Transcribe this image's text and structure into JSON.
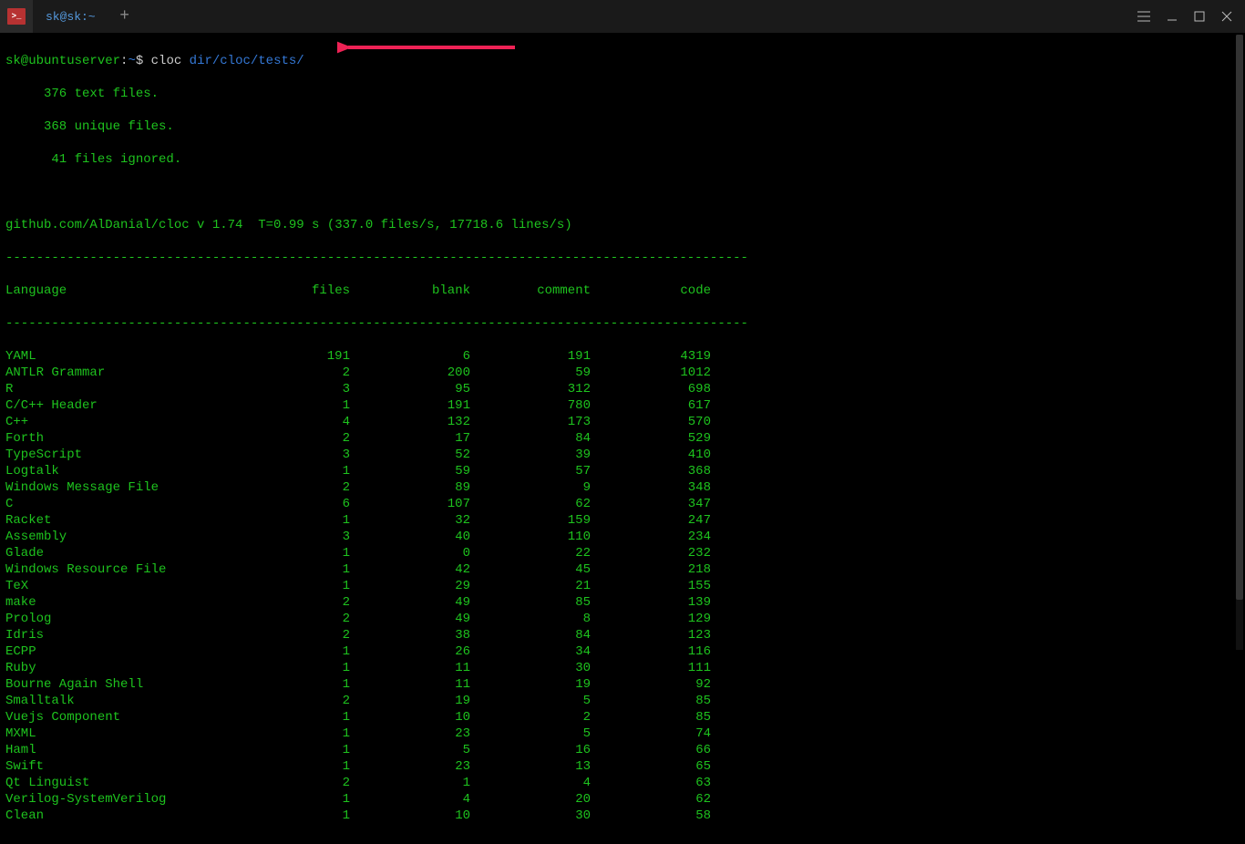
{
  "titlebar": {
    "tab_label": "sk@sk:~",
    "add_tab": "+"
  },
  "prompt": {
    "user_host": "sk@ubuntuserver",
    "path": "~",
    "command": "cloc ",
    "command_path": "dir/cloc/tests/"
  },
  "summary": {
    "line1": "     376 text files.",
    "line2": "     368 unique files.",
    "line3": "      41 files ignored."
  },
  "stats_line": "github.com/AlDanial/cloc v 1.74  T=0.99 s (337.0 files/s, 17718.6 lines/s)",
  "dashes": "-------------------------------------------------------------------------------------------------",
  "headers": {
    "language": "Language",
    "files": "files",
    "blank": "blank",
    "comment": "comment",
    "code": "code"
  },
  "rows": [
    {
      "lang": "YAML",
      "files": "191",
      "blank": "6",
      "comment": "191",
      "code": "4319"
    },
    {
      "lang": "ANTLR Grammar",
      "files": "2",
      "blank": "200",
      "comment": "59",
      "code": "1012"
    },
    {
      "lang": "R",
      "files": "3",
      "blank": "95",
      "comment": "312",
      "code": "698"
    },
    {
      "lang": "C/C++ Header",
      "files": "1",
      "blank": "191",
      "comment": "780",
      "code": "617"
    },
    {
      "lang": "C++",
      "files": "4",
      "blank": "132",
      "comment": "173",
      "code": "570"
    },
    {
      "lang": "Forth",
      "files": "2",
      "blank": "17",
      "comment": "84",
      "code": "529"
    },
    {
      "lang": "TypeScript",
      "files": "3",
      "blank": "52",
      "comment": "39",
      "code": "410"
    },
    {
      "lang": "Logtalk",
      "files": "1",
      "blank": "59",
      "comment": "57",
      "code": "368"
    },
    {
      "lang": "Windows Message File",
      "files": "2",
      "blank": "89",
      "comment": "9",
      "code": "348"
    },
    {
      "lang": "C",
      "files": "6",
      "blank": "107",
      "comment": "62",
      "code": "347"
    },
    {
      "lang": "Racket",
      "files": "1",
      "blank": "32",
      "comment": "159",
      "code": "247"
    },
    {
      "lang": "Assembly",
      "files": "3",
      "blank": "40",
      "comment": "110",
      "code": "234"
    },
    {
      "lang": "Glade",
      "files": "1",
      "blank": "0",
      "comment": "22",
      "code": "232"
    },
    {
      "lang": "Windows Resource File",
      "files": "1",
      "blank": "42",
      "comment": "45",
      "code": "218"
    },
    {
      "lang": "TeX",
      "files": "1",
      "blank": "29",
      "comment": "21",
      "code": "155"
    },
    {
      "lang": "make",
      "files": "2",
      "blank": "49",
      "comment": "85",
      "code": "139"
    },
    {
      "lang": "Prolog",
      "files": "2",
      "blank": "49",
      "comment": "8",
      "code": "129"
    },
    {
      "lang": "Idris",
      "files": "2",
      "blank": "38",
      "comment": "84",
      "code": "123"
    },
    {
      "lang": "ECPP",
      "files": "1",
      "blank": "26",
      "comment": "34",
      "code": "116"
    },
    {
      "lang": "Ruby",
      "files": "1",
      "blank": "11",
      "comment": "30",
      "code": "111"
    },
    {
      "lang": "Bourne Again Shell",
      "files": "1",
      "blank": "11",
      "comment": "19",
      "code": "92"
    },
    {
      "lang": "Smalltalk",
      "files": "2",
      "blank": "19",
      "comment": "5",
      "code": "85"
    },
    {
      "lang": "Vuejs Component",
      "files": "1",
      "blank": "10",
      "comment": "2",
      "code": "85"
    },
    {
      "lang": "MXML",
      "files": "1",
      "blank": "23",
      "comment": "5",
      "code": "74"
    },
    {
      "lang": "Haml",
      "files": "1",
      "blank": "5",
      "comment": "16",
      "code": "66"
    },
    {
      "lang": "Swift",
      "files": "1",
      "blank": "23",
      "comment": "13",
      "code": "65"
    },
    {
      "lang": "Qt Linguist",
      "files": "2",
      "blank": "1",
      "comment": "4",
      "code": "63"
    },
    {
      "lang": "Verilog-SystemVerilog",
      "files": "1",
      "blank": "4",
      "comment": "20",
      "code": "62"
    },
    {
      "lang": "Clean",
      "files": "1",
      "blank": "10",
      "comment": "30",
      "code": "58"
    }
  ]
}
